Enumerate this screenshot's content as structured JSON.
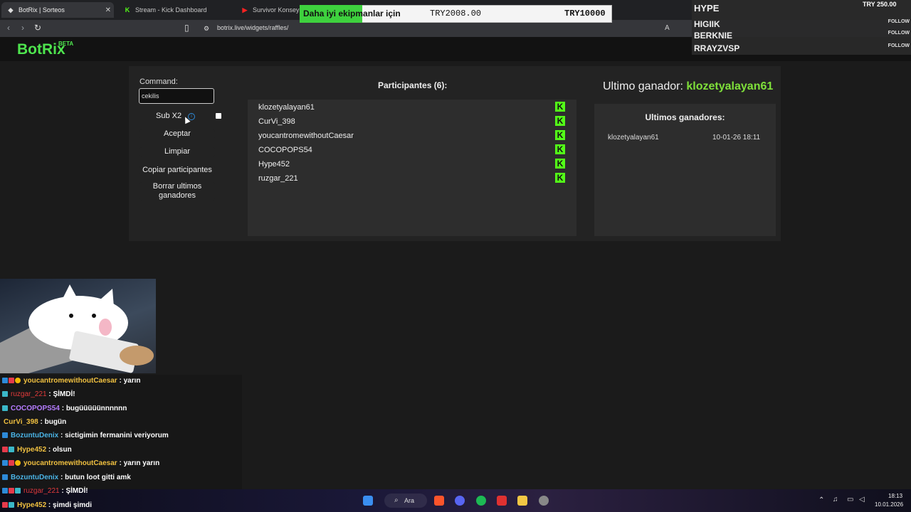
{
  "browser": {
    "tabs": [
      {
        "title": "BotRix | Sorteos",
        "active": true
      },
      {
        "title": "Stream - Kick Dashboard",
        "active": false
      },
      {
        "title": "Survivor Konsey",
        "active": false
      }
    ],
    "url": "botrix.live/widgets/raffles/"
  },
  "header": {
    "logo": "BotRix",
    "beta": "BETA"
  },
  "controls": {
    "command_label": "Command:",
    "command_value": "cekilis",
    "sub_label": "Sub X2",
    "buttons": [
      "Aceptar",
      "Limpiar",
      "Copiar participantes",
      "Borrar ultimos ganadores"
    ]
  },
  "participants": {
    "title": "Participantes (6):",
    "list": [
      "klozetyalayan61",
      "CurVi_398",
      "youcantromewithoutCaesar",
      "COCOPOPS54",
      "Hype452",
      "ruzgar_221"
    ]
  },
  "winners": {
    "last_label": "Ultimo ganador:",
    "last_name": "klozetyalayan61",
    "list_title": "Ultimos ganadores:",
    "rows": [
      {
        "name": "klozetyalayan61",
        "date": "10-01-26 18:11"
      }
    ]
  },
  "overlay_goal": {
    "text": "Daha iyi ekipmanlar için",
    "current": "TRY2008.00",
    "target": "TRY10000",
    "progress": 0.2
  },
  "follow_overlay": {
    "top_amount": "TRY 250.00",
    "names": [
      "HYPE",
      "HIGIIK",
      "BERKNIE",
      "RRAYZVSP"
    ],
    "follow_label": "FOLLOW"
  },
  "chat": [
    {
      "user": "youcantromewithoutCaesar",
      "msg": "yarın",
      "color": "#f0c040"
    },
    {
      "user": "ruzgar_221",
      "msg": "ŞİMDİ!",
      "color": "#e23b3b"
    },
    {
      "user": "COCOPOPS54",
      "msg": "bugüüüüünnnnnn",
      "color": "#b57cff"
    },
    {
      "user": "CurVi_398",
      "msg": "bugün",
      "color": "#f0c040"
    },
    {
      "user": "BozuntuDenix",
      "msg": "sictigimin fermanini veriyorum",
      "color": "#4ab4e6"
    },
    {
      "user": "Hype452",
      "msg": "olsun",
      "color": "#f0c040"
    },
    {
      "user": "youcantromewithoutCaesar",
      "msg": "yarın yarın",
      "color": "#f0c040"
    },
    {
      "user": "BozuntuDenix",
      "msg": "butun loot gitti amk",
      "color": "#4ab4e6"
    },
    {
      "user": "ruzgar_221",
      "msg": "ŞİMDİ!",
      "color": "#e23b3b"
    },
    {
      "user": "Hype452",
      "msg": "şimdi şimdi",
      "color": "#f0c040"
    }
  ],
  "taskbar": {
    "search": "Ara",
    "time": "18:13",
    "date": "10.01.2026"
  }
}
